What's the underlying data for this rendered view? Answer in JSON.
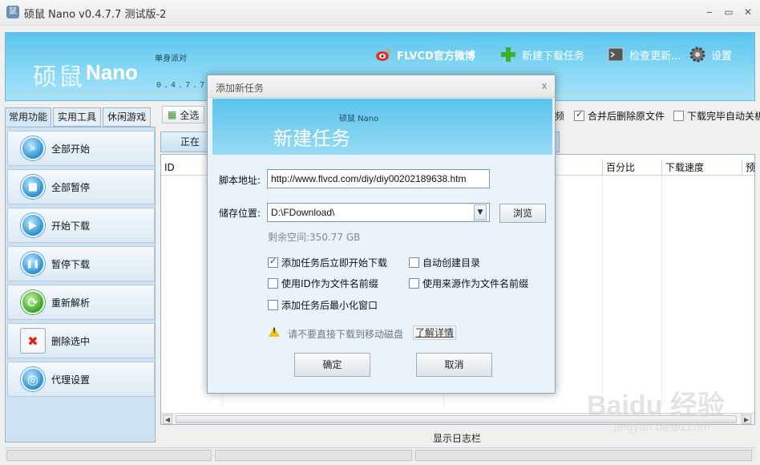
{
  "window": {
    "title": "硕鼠 Nano v0.4.7.7 测试版-2",
    "app_icon": "mouse-app-icon",
    "minimize": "‒",
    "maximize": "▭",
    "close": "✕"
  },
  "banner": {
    "logo_text_a": "硕鼠",
    "logo_text_b": "Nano",
    "slogan": "单身派对",
    "version_strip": "0.4.7.7 Be",
    "links": [
      {
        "label": "FLVCD官方微博",
        "icon": "weibo-icon"
      },
      {
        "label": "新建下载任务",
        "icon": "plus-icon"
      },
      {
        "label": "检查更新...",
        "icon": "terminal-icon"
      },
      {
        "label": "设置",
        "icon": "gear-icon"
      }
    ]
  },
  "side_tabs": [
    "常用功能",
    "实用工具",
    "休闲游戏"
  ],
  "sidebar": [
    {
      "label": "全部开始",
      "icon": "fast-forward-icon",
      "glyph": "»"
    },
    {
      "label": "全部暂停",
      "icon": "stop-icon",
      "glyph": "■"
    },
    {
      "label": "开始下载",
      "icon": "play-icon",
      "glyph": "▶"
    },
    {
      "label": "暂停下载",
      "icon": "pause-icon",
      "glyph": "❚❚"
    },
    {
      "label": "重新解析",
      "icon": "refresh-icon",
      "glyph": "⟳"
    },
    {
      "label": "删除选中",
      "icon": "delete-icon",
      "glyph": "✖"
    },
    {
      "label": "代理设置",
      "icon": "globe-icon",
      "glyph": "◎"
    }
  ],
  "toolbar": {
    "select_all": "全选",
    "frequency_fragment": "频",
    "merge_delete": "合并后删除原文件",
    "merge_delete_checked": true,
    "auto_close": "下载完毕自动关机",
    "auto_close_checked": false
  },
  "content_tab": "正在下",
  "columns": [
    "ID",
    "百分比",
    "下载速度",
    "预"
  ],
  "log_bar": "显示日志栏",
  "dialog": {
    "title": "添加新任务",
    "close": "x",
    "brand": "硕鼠 Nano",
    "header": "新建任务",
    "script_label": "脚本地址:",
    "script_value": "http://www.flvcd.com/diy/diy00202189638.htm",
    "save_label": "储存位置:",
    "save_value": "D:\\FDownload\\",
    "browse": "浏览",
    "free_space": "剩余空间:350.77 GB",
    "options": [
      {
        "label": "添加任务后立即开始下载",
        "checked": true
      },
      {
        "label": "自动创建目录",
        "checked": false
      },
      {
        "label": "使用ID作为文件名前缀",
        "checked": false
      },
      {
        "label": "使用来源作为文件名前缀",
        "checked": false
      },
      {
        "label": "添加任务后最小化窗口",
        "checked": false
      }
    ],
    "warning": "请不要直接下载到移动磁盘",
    "detail_link": "了解详情",
    "ok": "确定",
    "cancel": "取消"
  },
  "watermark": {
    "main": "Baidu 经验",
    "sub": "jingyan.baidu.com"
  }
}
